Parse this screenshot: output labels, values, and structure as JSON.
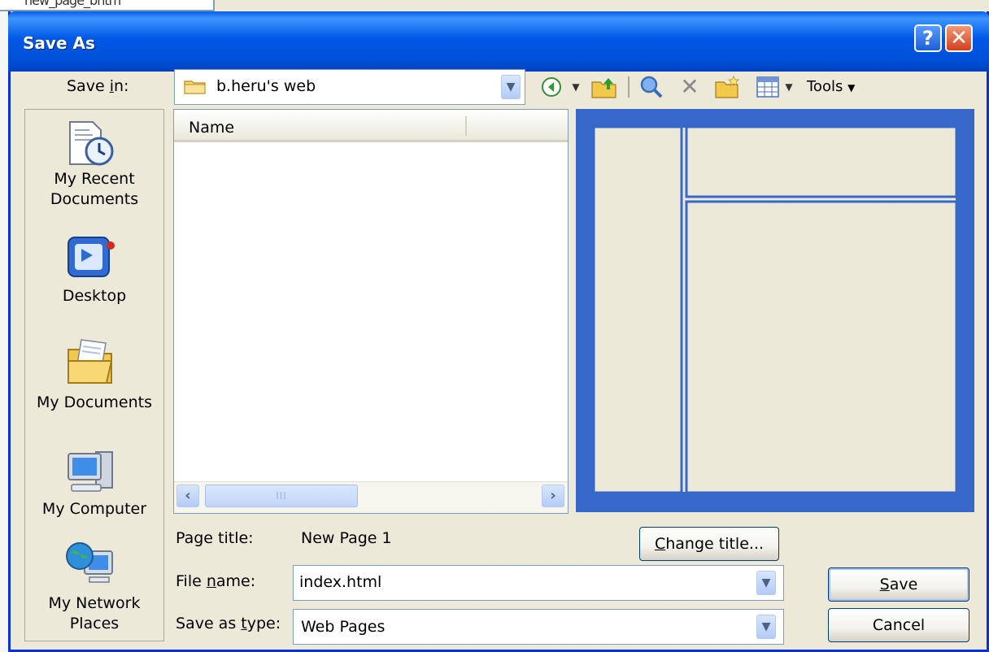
{
  "dialog": {
    "title": "Save As",
    "help_glyph": "?",
    "close_glyph": "✕"
  },
  "background": {
    "tab_text": "new_page_bhtm"
  },
  "save_in": {
    "label": "Save in:",
    "value": "b.heru's web"
  },
  "toolbar": {
    "back_icon": "back-arrow-icon",
    "up_icon": "up-one-level-icon",
    "search_icon": "search-web-icon",
    "delete_icon": "delete-icon",
    "new_folder_icon": "new-folder-icon",
    "views_icon": "views-icon",
    "tools_label": "Tools"
  },
  "places": [
    {
      "id": "recent",
      "label_line1": "My Recent",
      "label_line2": "Documents"
    },
    {
      "id": "desktop",
      "label_line1": "Desktop"
    },
    {
      "id": "documents",
      "label_line1": "My Documents"
    },
    {
      "id": "computer",
      "label_line1": "My Computer"
    },
    {
      "id": "network",
      "label_line1": "My Network",
      "label_line2": "Places"
    }
  ],
  "file_list": {
    "columns": [
      "Name"
    ],
    "scroll_thumb_glyph": "III"
  },
  "page_title": {
    "label": "Page title:",
    "value": "New Page 1",
    "change_button": "Change title..."
  },
  "file_name": {
    "label": "File name:",
    "value": "index.html"
  },
  "save_as_type": {
    "label": "Save as type:",
    "value": "Web Pages"
  },
  "buttons": {
    "save": "Save",
    "cancel": "Cancel"
  },
  "colors": {
    "titlebar": "#0058e6",
    "dialog_face": "#ece9d8",
    "preview_frame": "#3668c9",
    "preview_panel": "#ece9d8",
    "input_border": "#7f9db9"
  }
}
